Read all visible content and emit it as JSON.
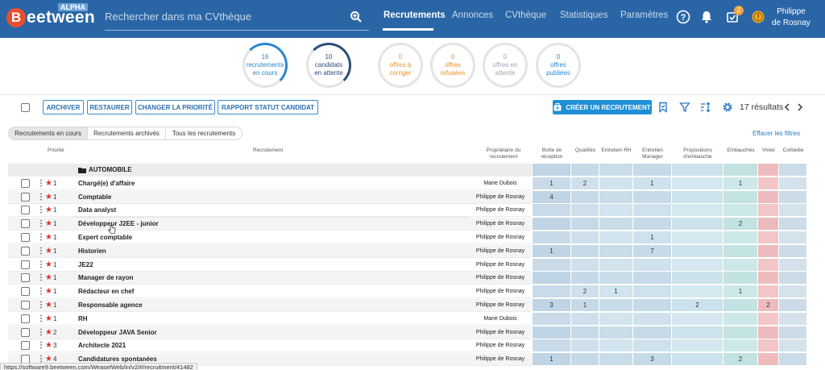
{
  "header": {
    "logo_letter": "B",
    "logo_text": "eetween",
    "logo_badge": "ALPHA",
    "search_placeholder": "Rechercher dans ma CVthèque",
    "nav": [
      {
        "label": "Recrutements",
        "active": true
      },
      {
        "label": "Annonces",
        "active": false
      },
      {
        "label": "CVthèque",
        "active": false
      },
      {
        "label": "Statistiques",
        "active": false
      },
      {
        "label": "Paramètres",
        "active": false
      }
    ],
    "notification_count": "2",
    "user_first": "Philippe",
    "user_last": "de Rosnay"
  },
  "stats": [
    {
      "num": "16",
      "label": "recrutements en cours",
      "color": "#2a88d0",
      "ring": "#2a88d0"
    },
    {
      "num": "10",
      "label": "candidats en attente",
      "color": "#2a4f7a",
      "ring": "#2a4f7a"
    },
    {
      "num": "0",
      "label": "offres à corriger",
      "color": "#e8922a",
      "ring": "#e2e2e2"
    },
    {
      "num": "0",
      "label": "offres refusées",
      "color": "#e8922a",
      "ring": "#e2e2e2"
    },
    {
      "num": "0",
      "label": "offres en attente",
      "color": "#9aa6b2",
      "ring": "#e2e2e2"
    },
    {
      "num": "0",
      "label": "offres publiées",
      "color": "#2a88d0",
      "ring": "#e2e2e2"
    }
  ],
  "toolbar": {
    "archive": "ARCHIVER",
    "restore": "RESTAURER",
    "priority": "CHANGER LA PRIORITÉ",
    "report": "RAPPORT STATUT CANDIDAT",
    "create": "CRÉER UN RECRUTEMENT",
    "results": "17 résultats"
  },
  "tabs": [
    "Recrutements en cours",
    "Recrutements archivés",
    "Tous les recrutements"
  ],
  "clear_filters": "Effacer les filtres",
  "columns": {
    "priority": "Priorité",
    "recruitment": "Recrutement",
    "owner": "Propriétaire du recrutement",
    "stages": [
      "Boîte de réception",
      "Qualifiés",
      "Entretien RH",
      "Entretien Manager",
      "Propositions d'embauche",
      "Embauchés",
      "Vivier",
      "Corbeille"
    ]
  },
  "group": "AUTOMOBILE",
  "rows": [
    {
      "prio": "1",
      "name": "Chargé(e) d'affaire",
      "owner": "Marie Dubois",
      "counts": [
        "1",
        "2",
        "",
        "1",
        "",
        "1",
        "",
        ""
      ]
    },
    {
      "prio": "1",
      "name": "Comptable",
      "owner": "Philippe de Rosnay",
      "counts": [
        "4",
        "",
        "",
        "",
        "",
        "",
        "",
        ""
      ]
    },
    {
      "prio": "1",
      "name": "Data analyst",
      "owner": "Philippe de Rosnay",
      "counts": [
        "",
        "",
        "",
        "",
        "",
        "",
        "",
        ""
      ]
    },
    {
      "prio": "1",
      "name": "Développeur J2EE - junior",
      "owner": "Philippe de Rosnay",
      "counts": [
        "",
        "",
        "",
        "",
        "",
        "2",
        "",
        ""
      ]
    },
    {
      "prio": "1",
      "name": "Expert comptable",
      "owner": "Philippe de Rosnay",
      "counts": [
        "",
        "",
        "",
        "1",
        "",
        "",
        "",
        ""
      ]
    },
    {
      "prio": "1",
      "name": "Historien",
      "owner": "Philippe de Rosnay",
      "counts": [
        "1",
        "",
        "",
        "7",
        "",
        "",
        "",
        ""
      ]
    },
    {
      "prio": "1",
      "name": "JE22",
      "owner": "Philippe de Rosnay",
      "counts": [
        "",
        "",
        "",
        "",
        "",
        "",
        "",
        ""
      ]
    },
    {
      "prio": "1",
      "name": "Manager de rayon",
      "owner": "Philippe de Rosnay",
      "counts": [
        "",
        "",
        "",
        "",
        "",
        "",
        "",
        ""
      ]
    },
    {
      "prio": "1",
      "name": "Rédacteur en chef",
      "owner": "Philippe de Rosnay",
      "counts": [
        "",
        "2",
        "1",
        "",
        "",
        "1",
        "",
        ""
      ]
    },
    {
      "prio": "1",
      "name": "Responsable agence",
      "owner": "Philippe de Rosnay",
      "counts": [
        "3",
        "1",
        "",
        "",
        "2",
        "",
        "2",
        ""
      ]
    },
    {
      "prio": "1",
      "name": "RH",
      "owner": "Marie Dubois",
      "counts": [
        "",
        "",
        "",
        "",
        "",
        "",
        "",
        ""
      ]
    },
    {
      "prio": "2",
      "name": "Développeur JAVA Senior",
      "owner": "Philippe de Rosnay",
      "counts": [
        "",
        "",
        "",
        "",
        "",
        "",
        "",
        ""
      ]
    },
    {
      "prio": "3",
      "name": "Architecte 2021",
      "owner": "Philippe de Rosnay",
      "counts": [
        "",
        "",
        "",
        "",
        "",
        "",
        "",
        ""
      ]
    },
    {
      "prio": "4",
      "name": "Candidatures spontanées",
      "owner": "Philippe de Rosnay",
      "counts": [
        "1",
        "",
        "",
        "3",
        "",
        "2",
        "",
        ""
      ]
    }
  ],
  "status_url": "https://software9.beetween.com/WeaselWeb/in/v2/#/recruitment/41482"
}
